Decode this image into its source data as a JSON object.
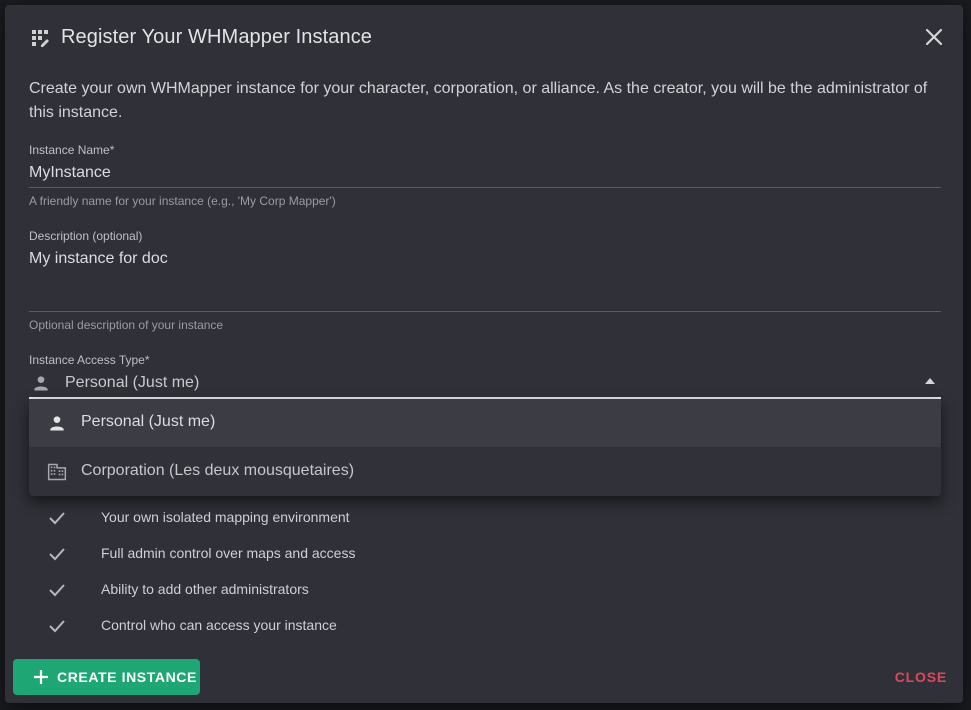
{
  "dialog": {
    "title": "Register Your WHMapper Instance",
    "title_icon": "register-instance-icon",
    "close_icon": "close-icon",
    "intro": "Create your own WHMapper instance for your character, corporation, or alliance. As the creator, you will be the administrator of this instance."
  },
  "fields": {
    "name": {
      "label": "Instance Name*",
      "value": "MyInstance",
      "hint": "A friendly name for your instance (e.g., 'My Corp Mapper')"
    },
    "description": {
      "label": "Description (optional)",
      "value": "My instance for doc",
      "hint": "Optional description of your instance"
    },
    "access_type": {
      "label": "Instance Access Type*",
      "value": "Personal (Just me)",
      "icon": "person-icon",
      "options": [
        {
          "label": "Personal (Just me)",
          "icon": "person-icon",
          "selected": true
        },
        {
          "label": "Corporation (Les deux mousquetaires)",
          "icon": "building-icon",
          "selected": false
        }
      ]
    }
  },
  "features": [
    "Your own isolated mapping environment",
    "Full admin control over maps and access",
    "Ability to add other administrators",
    "Control who can access your instance"
  ],
  "actions": {
    "create_label": "CREATE INSTANCE",
    "close_label": "CLOSE"
  },
  "colors": {
    "background": "#2f3038",
    "primary": "#1ea774",
    "danger": "#e0475b"
  }
}
